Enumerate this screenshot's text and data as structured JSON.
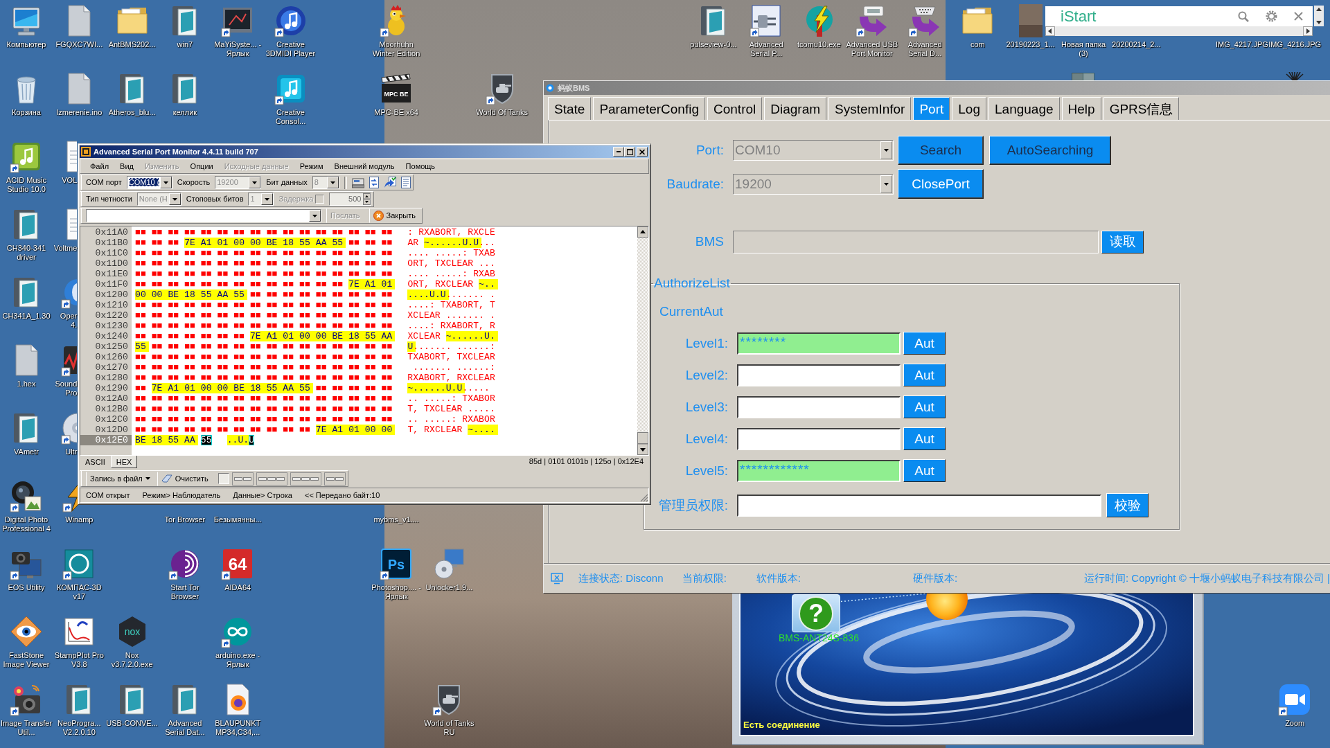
{
  "desktop": {
    "icons": [
      {
        "label": "Компьютер",
        "kind": "computer",
        "shortcut": false
      },
      {
        "label": "Корзина",
        "kind": "bin",
        "shortcut": false
      },
      {
        "label": "ACID Music Studio 10.0",
        "kind": "music",
        "shortcut": true
      },
      {
        "label": "CH340-341 driver",
        "kind": "setup",
        "shortcut": false
      },
      {
        "label": "CH341A_1.30",
        "kind": "setup",
        "shortcut": false
      },
      {
        "label": "1.hex",
        "kind": "file",
        "shortcut": false
      },
      {
        "label": "VAmetr",
        "kind": "setup",
        "shortcut": false
      },
      {
        "label": "Digital Photo Professional 4",
        "kind": "lens",
        "shortcut": true
      },
      {
        "label": "EOS Utility",
        "kind": "camera",
        "shortcut": true
      },
      {
        "label": "FastStone Image Viewer",
        "kind": "eye",
        "shortcut": false
      },
      {
        "label": "Image Transfer Util...",
        "kind": "photo-camera",
        "shortcut": true
      },
      {
        "label": "FGQXC7WI...",
        "kind": "file",
        "shortcut": false
      },
      {
        "label": "Izmerenie.ino",
        "kind": "file",
        "shortcut": false
      },
      {
        "label": "VOL",
        "kind": "page",
        "shortcut": false
      },
      {
        "label": "Voltme",
        "kind": "page",
        "shortcut": false
      },
      {
        "label": "Oper 4.",
        "kind": "swirl",
        "shortcut": true
      },
      {
        "label": "Sound Pro",
        "kind": "sound",
        "shortcut": true
      },
      {
        "label": "Ultr",
        "kind": "disc",
        "shortcut": true
      },
      {
        "label": "Winamp",
        "kind": "winamp",
        "shortcut": true
      },
      {
        "label": "КОМПАС-3D v17",
        "kind": "ring",
        "shortcut": true
      },
      {
        "label": "StampPlot Pro V3.8",
        "kind": "chart",
        "shortcut": false
      },
      {
        "label": "NeoProgra... V2.2.0.10",
        "kind": "setup",
        "shortcut": false
      },
      {
        "label": "AntBMS202...",
        "kind": "folder",
        "shortcut": false
      },
      {
        "label": "Atheros_blu...",
        "kind": "setup",
        "shortcut": false
      },
      {
        "label": "Nox v3.7.2.0.exe",
        "kind": "hexagon",
        "icon_text": "nox",
        "shortcut": false
      },
      {
        "label": "USB-CONVE...",
        "kind": "setup",
        "shortcut": false
      },
      {
        "label": "win7",
        "kind": "setup",
        "shortcut": false
      },
      {
        "label": "келлик",
        "kind": "setup",
        "shortcut": false
      },
      {
        "label": "Tor Browser"
      },
      {
        "label": "Start Tor Browser",
        "kind": "onion",
        "shortcut": true
      },
      {
        "label": "Advanced Serial Dat...",
        "kind": "setup",
        "shortcut": false
      },
      {
        "label": "MaYiSyste... - Ярлык",
        "kind": "screen-app",
        "shortcut": true
      },
      {
        "label": "Безымянны..."
      },
      {
        "label": "AIDA64",
        "kind": "tile",
        "icon_text": "64",
        "shortcut": true
      },
      {
        "label": "arduino.exe - Ярлык",
        "kind": "infinity",
        "shortcut": true
      },
      {
        "label": "BLAUPUNKT MP34,C34,...",
        "kind": "web-doc",
        "shortcut": false
      },
      {
        "label": "Creative 3DMIDI Player",
        "kind": "midi",
        "shortcut": true
      },
      {
        "label": "Creative Consol...",
        "kind": "console",
        "shortcut": true
      },
      {
        "label": "Moorhuhn Winter Edition",
        "kind": "chicken",
        "shortcut": true
      },
      {
        "label": "MPC-BE x64",
        "kind": "clapper",
        "icon_text": "MPC BE",
        "shortcut": false
      },
      {
        "label": "mybms_v1...."
      },
      {
        "label": "Photoshop.... - Ярлык",
        "kind": "ps",
        "icon_text": "Ps",
        "shortcut": true
      },
      {
        "label": "Unlocker1.9...",
        "kind": "setup-disc",
        "shortcut": false
      },
      {
        "label": "World of Tanks RU",
        "kind": "tank",
        "shortcut": true
      },
      {
        "label": "World Of Tanks",
        "kind": "tank",
        "shortcut": true
      },
      {
        "label": "pulseview-0...",
        "kind": "setup",
        "shortcut": false
      },
      {
        "label": "Advanced Serial P...",
        "kind": "plug",
        "shortcut": true
      },
      {
        "label": "tcomu10.exe",
        "kind": "bolt",
        "shortcut": false
      },
      {
        "label": "Advanced USB Port Monitor",
        "kind": "usb-arrow",
        "shortcut": true
      },
      {
        "label": "Advanced Serial D...",
        "kind": "port-arrow",
        "shortcut": true
      },
      {
        "label": "com",
        "kind": "folder",
        "shortcut": false
      },
      {
        "label": "20190223_1...",
        "kind": "photo",
        "shortcut": false
      },
      {
        "label": "Новая папка (3)"
      },
      {
        "kind": "boxes"
      },
      {
        "label": "20200214_2..."
      },
      {
        "label": "IMG_4217.JPG"
      },
      {
        "label": "IMG_4216.JPG"
      },
      {
        "kind": "spikes"
      },
      {
        "label": "Zoom",
        "kind": "video",
        "shortcut": true
      }
    ]
  },
  "istart": {
    "title": "iStart"
  },
  "serial_monitor": {
    "title": "Advanced Serial Port Monitor 4.4.11 build 707",
    "menu": [
      {
        "label": "Файл",
        "disabled": false
      },
      {
        "label": "Вид",
        "disabled": false
      },
      {
        "label": "Изменить",
        "disabled": true
      },
      {
        "label": "Опции",
        "disabled": false
      },
      {
        "label": "Исходные данные",
        "disabled": true
      },
      {
        "label": "Режим",
        "disabled": false
      },
      {
        "label": "Внешний модуль",
        "disabled": false
      },
      {
        "label": "Помощь",
        "disabled": false
      }
    ],
    "port_toolbar": {
      "port": {
        "label": "COM порт",
        "value": "COM10 (",
        "focused": true,
        "disabled": false
      },
      "speed": {
        "label": "Скорость",
        "value": "19200",
        "disabled": true
      },
      "data_bits": {
        "label": "Бит данных",
        "value": "8",
        "disabled": true
      }
    },
    "line_toolbar": {
      "parity": {
        "label": "Тип четности",
        "value": "None (H",
        "disabled": true
      },
      "stop_bits": {
        "label": "Стоповых битов",
        "value": "1",
        "disabled": true
      },
      "delay": {
        "label": "Задержка",
        "checked": false,
        "disabled": true
      },
      "interval": {
        "value": "500",
        "disabled": true
      }
    },
    "send_toolbar": {
      "send": {
        "label": "Послать",
        "disabled": true
      },
      "close": {
        "label": "Закрыть",
        "disabled": false
      }
    },
    "rows": [
      {
        "address": "0x11A0",
        "current": false,
        "bytes": [
          {
            "text": "■■ ■■ ■■ ■■ ■■ ■■ ■■ ■■ ■■ ■■ ■■ ■■ ■■ ■■ ■■ ■■",
            "kind": "plain"
          }
        ],
        "ascii": [
          {
            "text": ": RXABORT, RXCLE",
            "kind": "plain"
          }
        ]
      },
      {
        "address": "0x11B0",
        "current": false,
        "bytes": [
          {
            "text": "■■ ■■ ■■",
            "kind": "plain"
          },
          {
            "text": "7E A1 01 00 00 BE 18 55 AA 55",
            "kind": "highlight"
          },
          {
            "text": "■■ ■■ ■■",
            "kind": "plain"
          }
        ],
        "ascii": [
          {
            "text": "AR ",
            "kind": "plain"
          },
          {
            "text": "~......U.U",
            "kind": "highlight"
          },
          {
            "text": "...",
            "kind": "plain"
          }
        ]
      },
      {
        "address": "0x11C0",
        "current": false,
        "bytes": [
          {
            "text": "■■ ■■ ■■ ■■ ■■ ■■ ■■ ■■ ■■ ■■ ■■ ■■ ■■ ■■ ■■ ■■",
            "kind": "plain"
          }
        ],
        "ascii": [
          {
            "text": ".... .....: TXAB",
            "kind": "plain"
          }
        ]
      },
      {
        "address": "0x11D0",
        "current": false,
        "bytes": [
          {
            "text": "■■ ■■ ■■ ■■ ■■ ■■ ■■ ■■ ■■ ■■ ■■ ■■ ■■ ■■ ■■ ■■",
            "kind": "plain"
          }
        ],
        "ascii": [
          {
            "text": "ORT, TXCLEAR ...",
            "kind": "plain"
          }
        ]
      },
      {
        "address": "0x11E0",
        "current": false,
        "bytes": [
          {
            "text": "■■ ■■ ■■ ■■ ■■ ■■ ■■ ■■ ■■ ■■ ■■ ■■ ■■ ■■ ■■ ■■",
            "kind": "plain"
          }
        ],
        "ascii": [
          {
            "text": ".... .....: RXAB",
            "kind": "plain"
          }
        ]
      },
      {
        "address": "0x11F0",
        "current": false,
        "bytes": [
          {
            "text": "■■ ■■ ■■ ■■ ■■ ■■ ■■ ■■ ■■ ■■ ■■ ■■ ■■",
            "kind": "plain"
          },
          {
            "text": "7E A1 01",
            "kind": "highlight"
          }
        ],
        "ascii": [
          {
            "text": "ORT, RXCLEAR ",
            "kind": "plain"
          },
          {
            "text": "~..",
            "kind": "highlight"
          }
        ]
      },
      {
        "address": "0x1200",
        "current": false,
        "bytes": [
          {
            "text": "00 00 BE 18 55 AA 55",
            "kind": "highlight"
          },
          {
            "text": "■■ ■■ ■■ ■■ ■■ ■■ ■■ ■■ ■■",
            "kind": "plain"
          }
        ],
        "ascii": [
          {
            "text": "....U.U",
            "kind": "highlight"
          },
          {
            "text": "....... .",
            "kind": "plain"
          }
        ]
      },
      {
        "address": "0x1210",
        "current": false,
        "bytes": [
          {
            "text": "■■ ■■ ■■ ■■ ■■ ■■ ■■ ■■ ■■ ■■ ■■ ■■ ■■ ■■ ■■ ■■",
            "kind": "plain"
          }
        ],
        "ascii": [
          {
            "text": "....: TXABORT, T",
            "kind": "plain"
          }
        ]
      },
      {
        "address": "0x1220",
        "current": false,
        "bytes": [
          {
            "text": "■■ ■■ ■■ ■■ ■■ ■■ ■■ ■■ ■■ ■■ ■■ ■■ ■■ ■■ ■■ ■■",
            "kind": "plain"
          }
        ],
        "ascii": [
          {
            "text": "XCLEAR ....... .",
            "kind": "plain"
          }
        ]
      },
      {
        "address": "0x1230",
        "current": false,
        "bytes": [
          {
            "text": "■■ ■■ ■■ ■■ ■■ ■■ ■■ ■■ ■■ ■■ ■■ ■■ ■■ ■■ ■■ ■■",
            "kind": "plain"
          }
        ],
        "ascii": [
          {
            "text": "....: RXABORT, R",
            "kind": "plain"
          }
        ]
      },
      {
        "address": "0x1240",
        "current": false,
        "bytes": [
          {
            "text": "■■ ■■ ■■ ■■ ■■ ■■ ■■",
            "kind": "plain"
          },
          {
            "text": "7E A1 01 00 00 BE 18 55 AA",
            "kind": "highlight"
          }
        ],
        "ascii": [
          {
            "text": "XCLEAR ",
            "kind": "plain"
          },
          {
            "text": "~......U.",
            "kind": "highlight"
          }
        ]
      },
      {
        "address": "0x1250",
        "current": false,
        "bytes": [
          {
            "text": "55",
            "kind": "highlight"
          },
          {
            "text": "■■ ■■ ■■ ■■ ■■ ■■ ■■ ■■ ■■ ■■ ■■ ■■ ■■ ■■ ■■",
            "kind": "plain"
          }
        ],
        "ascii": [
          {
            "text": "U",
            "kind": "highlight"
          },
          {
            "text": "....... ......:",
            "kind": "plain"
          }
        ]
      },
      {
        "address": "0x1260",
        "current": false,
        "bytes": [
          {
            "text": "■■ ■■ ■■ ■■ ■■ ■■ ■■ ■■ ■■ ■■ ■■ ■■ ■■ ■■ ■■ ■■",
            "kind": "plain"
          }
        ],
        "ascii": [
          {
            "text": "TXABORT, TXCLEAR",
            "kind": "plain"
          }
        ]
      },
      {
        "address": "0x1270",
        "current": false,
        "bytes": [
          {
            "text": "■■ ■■ ■■ ■■ ■■ ■■ ■■ ■■ ■■ ■■ ■■ ■■ ■■ ■■ ■■ ■■",
            "kind": "plain"
          }
        ],
        "ascii": [
          {
            "text": " ....... ......:",
            "kind": "plain"
          }
        ]
      },
      {
        "address": "0x1280",
        "current": false,
        "bytes": [
          {
            "text": "■■ ■■ ■■ ■■ ■■ ■■ ■■ ■■ ■■ ■■ ■■ ■■ ■■ ■■ ■■ ■■",
            "kind": "plain"
          }
        ],
        "ascii": [
          {
            "text": "RXABORT, RXCLEAR",
            "kind": "plain"
          }
        ]
      },
      {
        "address": "0x1290",
        "current": false,
        "bytes": [
          {
            "text": "■■",
            "kind": "plain"
          },
          {
            "text": "7E A1 01 00 00 BE 18 55 AA 55",
            "kind": "highlight"
          },
          {
            "text": "■■ ■■ ■■ ■■ ■■",
            "kind": "plain"
          }
        ],
        "ascii": [
          {
            "text": "~......U.U",
            "kind": "highlight"
          },
          {
            "text": ".....",
            "kind": "plain"
          }
        ]
      },
      {
        "address": "0x12A0",
        "current": false,
        "bytes": [
          {
            "text": "■■ ■■ ■■ ■■ ■■ ■■ ■■ ■■ ■■ ■■ ■■ ■■ ■■ ■■ ■■ ■■",
            "kind": "plain"
          }
        ],
        "ascii": [
          {
            "text": ".. .....: TXABOR",
            "kind": "plain"
          }
        ]
      },
      {
        "address": "0x12B0",
        "current": false,
        "bytes": [
          {
            "text": "■■ ■■ ■■ ■■ ■■ ■■ ■■ ■■ ■■ ■■ ■■ ■■ ■■ ■■ ■■ ■■",
            "kind": "plain"
          }
        ],
        "ascii": [
          {
            "text": "T, TXCLEAR .....",
            "kind": "plain"
          }
        ]
      },
      {
        "address": "0x12C0",
        "current": false,
        "bytes": [
          {
            "text": "■■ ■■ ■■ ■■ ■■ ■■ ■■ ■■ ■■ ■■ ■■ ■■ ■■ ■■ ■■ ■■",
            "kind": "plain"
          }
        ],
        "ascii": [
          {
            "text": ".. .....: RXABOR",
            "kind": "plain"
          }
        ]
      },
      {
        "address": "0x12D0",
        "current": false,
        "bytes": [
          {
            "text": "■■ ■■ ■■ ■■ ■■ ■■ ■■ ■■ ■■ ■■ ■■",
            "kind": "plain"
          },
          {
            "text": "7E A1 01 00 00",
            "kind": "highlight"
          }
        ],
        "ascii": [
          {
            "text": "T, RXCLEAR ",
            "kind": "plain"
          },
          {
            "text": "~....",
            "kind": "highlight"
          }
        ]
      },
      {
        "address": "0x12E0",
        "current": true,
        "bytes": [
          {
            "text": "BE 18 55 AA",
            "kind": "highlight"
          },
          {
            "text": "55",
            "kind": "cursor"
          }
        ],
        "ascii": [
          {
            "text": "..U.",
            "kind": "highlight"
          },
          {
            "text": "U",
            "kind": "cursor"
          }
        ]
      }
    ],
    "view_tabs": [
      {
        "label": "ASCII",
        "selected": false
      },
      {
        "label": "HEX",
        "selected": true
      }
    ],
    "readout": "85d | 0101 0101b | 125o | 0x12E4",
    "log_toolbar": {
      "record": "Запись в файл",
      "clear": "Очистить",
      "checkbox": {
        "checked": false
      }
    },
    "status_bar": [
      "COM открыт",
      "Режим> Наблюдатель",
      "Данные> Строка",
      "<< Передано байт:10"
    ]
  },
  "bms_window": {
    "title": "蚂蚁BMS",
    "tabs": [
      {
        "label": "State",
        "selected": false
      },
      {
        "label": "ParameterConfig",
        "selected": false
      },
      {
        "label": "Control",
        "selected": false
      },
      {
        "label": "Diagram",
        "selected": false
      },
      {
        "label": "SystemInfor",
        "selected": false
      },
      {
        "label": "Port",
        "selected": true
      },
      {
        "label": "Log",
        "selected": false
      },
      {
        "label": "Language",
        "selected": false
      },
      {
        "label": "Help",
        "selected": false
      },
      {
        "label": "GPRS信息",
        "selected": false
      }
    ],
    "port": {
      "label": "Port:",
      "value": "COM10",
      "disabled": true,
      "buttons": [
        {
          "label": "Search",
          "disabled": true
        },
        {
          "label": "AutoSearching",
          "disabled": true
        }
      ]
    },
    "baudrate": {
      "label": "Baudrate:",
      "value": "19200",
      "disabled": true,
      "buttons": [
        {
          "label": "ClosePort",
          "disabled": false
        }
      ]
    },
    "bms": {
      "label": "BMS",
      "disabled": true,
      "button": "读取"
    },
    "authorize": {
      "title": "AuthorizeList",
      "current_label": "CurrentAut",
      "levels": [
        {
          "label": "Level1:",
          "value": "********",
          "authorized": true,
          "button": "Aut"
        },
        {
          "label": "Level2:",
          "authorized": false,
          "button": "Aut"
        },
        {
          "label": "Level3:",
          "authorized": false,
          "button": "Aut"
        },
        {
          "label": "Level4:",
          "authorized": false,
          "button": "Aut"
        },
        {
          "label": "Level5:",
          "value": "************",
          "authorized": true,
          "button": "Aut"
        }
      ],
      "admin": {
        "label": "管理员权限:",
        "button": "校验"
      }
    },
    "status_bar": {
      "connection_label": "连接状态:",
      "connection": "Disconn",
      "permission_label": "当前权限:",
      "software_label": "软件版本:",
      "hardware_label": "硬件版本:",
      "runtime_label": "运行时间:",
      "copyright": "Copyright © 十堰小蚂蚁电子科技有限公司 |"
    }
  },
  "connection_window": {
    "badge": "?",
    "device_label": "BMS-ANT24S-836",
    "status": "Есть соединение"
  }
}
